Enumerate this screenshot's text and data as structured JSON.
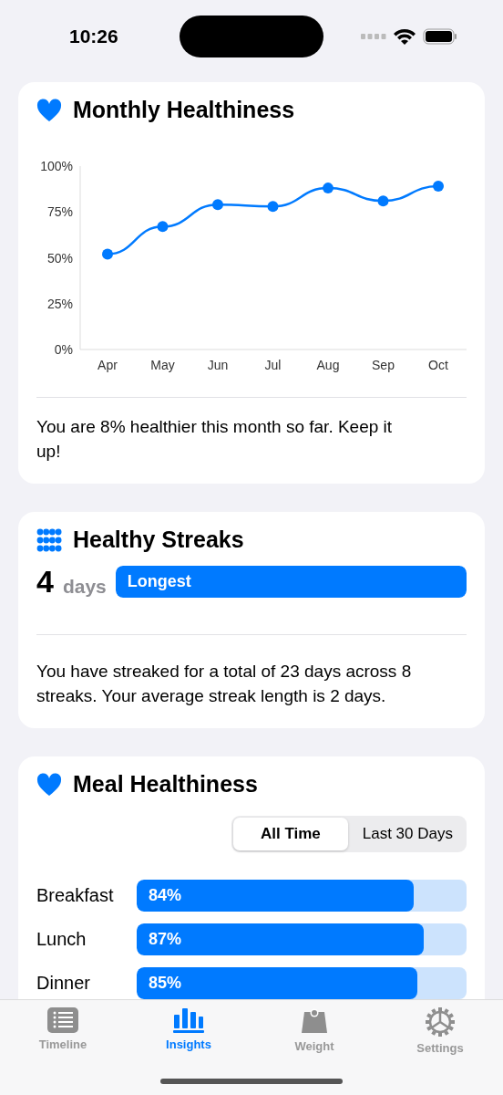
{
  "status_bar": {
    "time": "10:26"
  },
  "healthiness_card": {
    "title": "Monthly Healthiness",
    "chart_data": {
      "type": "line",
      "categories": [
        "Apr",
        "May",
        "Jun",
        "Jul",
        "Aug",
        "Sep",
        "Oct"
      ],
      "ylim": [
        0,
        100
      ],
      "yticks": [
        {
          "value": 0,
          "label": "0%"
        },
        {
          "value": 25,
          "label": "25%"
        },
        {
          "value": 50,
          "label": "50%"
        },
        {
          "value": 75,
          "label": "75%"
        },
        {
          "value": 100,
          "label": "100%"
        }
      ],
      "series": [
        {
          "color": "#007aff",
          "marker": true,
          "values": [
            52,
            67,
            79,
            78,
            88,
            81,
            89
          ]
        }
      ]
    },
    "summary": "You are 8% healthier this month so far. Keep it up!"
  },
  "streaks_card": {
    "title": "Healthy Streaks",
    "count": "4",
    "unit": "days",
    "bar": {
      "label": "Longest",
      "level": 1
    },
    "summary": "You have streaked for a total of 23 days across 8 streaks. Your average streak length is 2 days."
  },
  "meal_card": {
    "title": "Meal Healthiness",
    "segments": [
      {
        "label": "All Time",
        "selected": true
      },
      {
        "label": "Last 30 Days",
        "selected": false
      }
    ],
    "rows": [
      {
        "label": "Breakfast",
        "reading": "84%",
        "level": 0.84
      },
      {
        "label": "Lunch",
        "reading": "87%",
        "level": 0.87
      },
      {
        "label": "Dinner",
        "reading": "85%",
        "level": 0.85
      }
    ]
  },
  "tab_bar": [
    {
      "label": "Timeline",
      "kind": "timeline",
      "selected": false
    },
    {
      "label": "Insights",
      "kind": "insights",
      "selected": true
    },
    {
      "label": "Weight",
      "kind": "weight",
      "selected": false
    },
    {
      "label": "Settings",
      "kind": "settings",
      "selected": false
    }
  ]
}
